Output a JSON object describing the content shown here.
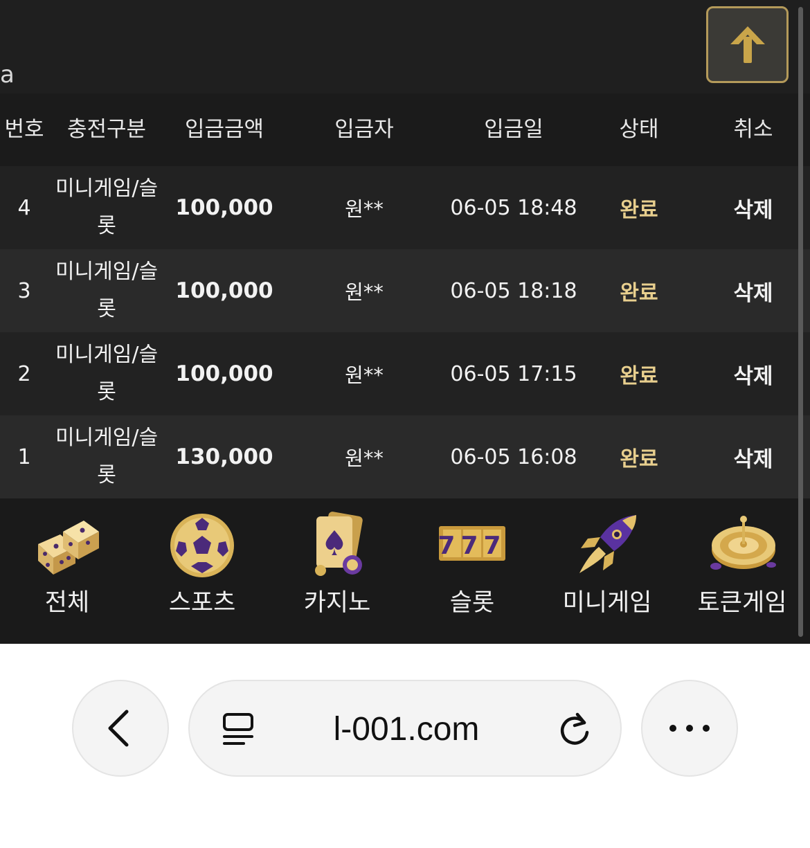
{
  "topbar": {
    "partial_text": "a",
    "scroll_top_icon": "arrow-up-icon"
  },
  "table": {
    "headers": [
      "번호",
      "충전구분",
      "입금금액",
      "입금자",
      "입금일",
      "상태",
      "취소"
    ],
    "rows": [
      {
        "num": "4",
        "type": "미니게임/슬롯",
        "amount": "100,000",
        "depositor": "원**",
        "date": "06-05 18:48",
        "status": "완료",
        "cancel": "삭제"
      },
      {
        "num": "3",
        "type": "미니게임/슬롯",
        "amount": "100,000",
        "depositor": "원**",
        "date": "06-05 18:18",
        "status": "완료",
        "cancel": "삭제"
      },
      {
        "num": "2",
        "type": "미니게임/슬롯",
        "amount": "100,000",
        "depositor": "원**",
        "date": "06-05 17:15",
        "status": "완료",
        "cancel": "삭제"
      },
      {
        "num": "1",
        "type": "미니게임/슬롯",
        "amount": "130,000",
        "depositor": "원**",
        "date": "06-05 16:08",
        "status": "완료",
        "cancel": "삭제"
      }
    ]
  },
  "bottom_nav": [
    {
      "label": "전체",
      "icon": "dice-icon"
    },
    {
      "label": "스포츠",
      "icon": "soccer-ball-icon"
    },
    {
      "label": "카지노",
      "icon": "playing-cards-icon"
    },
    {
      "label": "슬롯",
      "icon": "slot-777-icon",
      "icon_text": "777"
    },
    {
      "label": "미니게임",
      "icon": "rocket-icon"
    },
    {
      "label": "토큰게임",
      "icon": "roulette-icon"
    }
  ],
  "browser": {
    "url": "l-001.com",
    "back_icon": "chevron-left-icon",
    "reader_icon": "reader-mode-icon",
    "reload_icon": "reload-icon",
    "more_icon": "more-dots-icon"
  },
  "colors": {
    "gold": "#e8cf8e",
    "bg": "#1a1a1a",
    "row_alt": "#2a2a2a"
  }
}
